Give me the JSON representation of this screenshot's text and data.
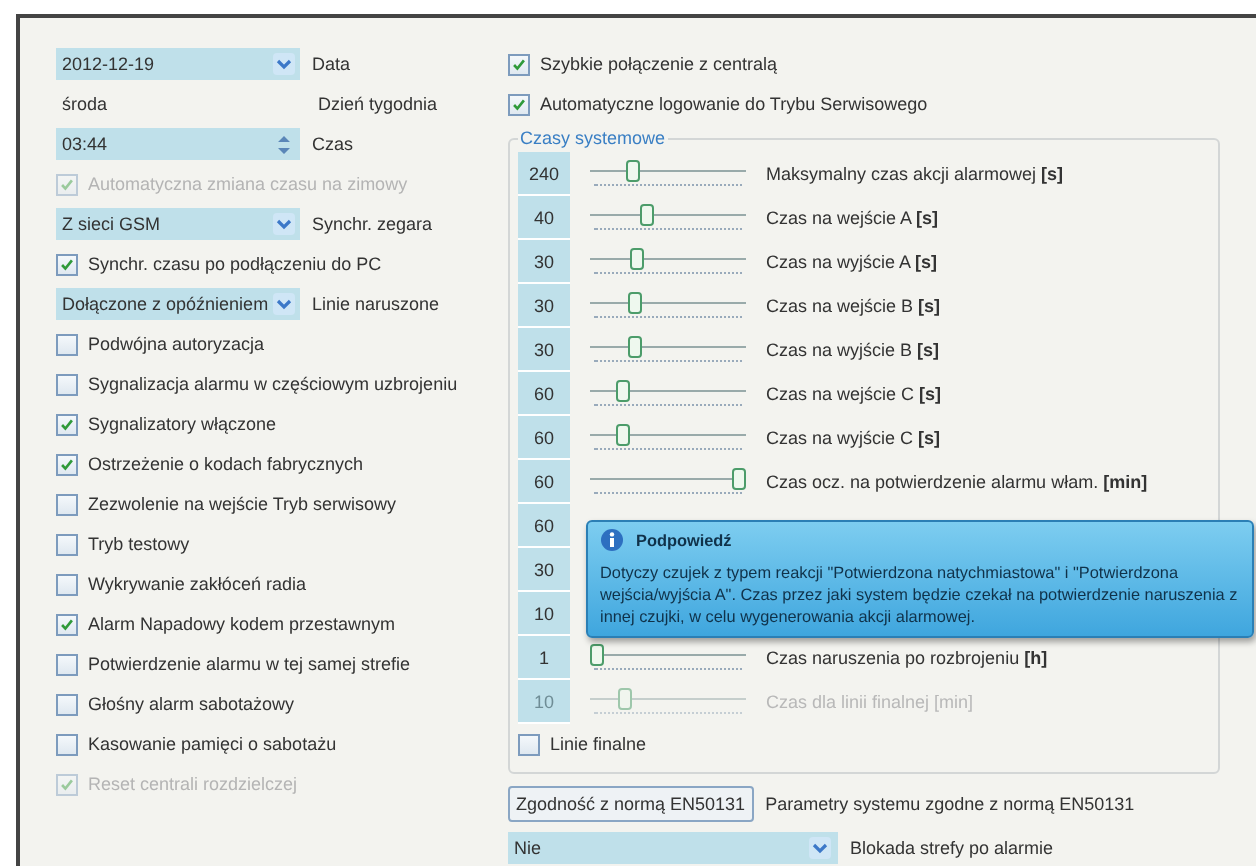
{
  "left_rows": [
    {
      "kind": "dropdown",
      "value": "2012-12-19",
      "label": "Data"
    },
    {
      "kind": "text",
      "value": "środa",
      "label": "Dzień tygodnia"
    },
    {
      "kind": "spinner",
      "value": "03:44",
      "label": "Czas"
    },
    {
      "kind": "checkbox",
      "text": "Automatyczna zmiana czasu na zimowy",
      "checked": true,
      "disabled": true
    },
    {
      "kind": "dropdown",
      "value": "Z sieci GSM",
      "label": "Synchr. zegara"
    },
    {
      "kind": "checkbox",
      "text": "Synchr. czasu po podłączeniu do PC",
      "checked": true,
      "disabled": false
    },
    {
      "kind": "dropdown",
      "value": "Dołączone z opóźnieniem",
      "label": "Linie naruszone"
    },
    {
      "kind": "checkbox",
      "label": "Podwójna autoryzacja",
      "checked": false,
      "disabled": false
    },
    {
      "kind": "checkbox",
      "label": "Sygnalizacja alarmu w częściowym uzbrojeniu",
      "checked": false,
      "disabled": false
    },
    {
      "kind": "checkbox",
      "label": "Sygnalizatory włączone",
      "checked": true,
      "disabled": false
    },
    {
      "kind": "checkbox",
      "label": "Ostrzeżenie o kodach fabrycznych",
      "checked": true,
      "disabled": false
    },
    {
      "kind": "checkbox",
      "label": "Zezwolenie na wejście Tryb serwisowy",
      "checked": false,
      "disabled": false
    },
    {
      "kind": "checkbox",
      "label": "Tryb testowy",
      "checked": false,
      "disabled": false
    },
    {
      "kind": "checkbox",
      "label": "Wykrywanie zakłóceń radia",
      "checked": false,
      "disabled": false
    },
    {
      "kind": "checkbox",
      "label": "Alarm Napadowy kodem przestawnym",
      "checked": true,
      "disabled": false
    },
    {
      "kind": "checkbox",
      "label": "Potwierdzenie alarmu w tej samej strefie",
      "checked": false,
      "disabled": false
    },
    {
      "kind": "checkbox",
      "label": "Głośny alarm sabotażowy",
      "checked": false,
      "disabled": false
    },
    {
      "kind": "checkbox",
      "label": "Kasowanie pamięci o sabotażu",
      "checked": false,
      "disabled": false
    },
    {
      "kind": "checkbox",
      "label": "Reset centrali rozdzielczej",
      "checked": true,
      "disabled": true
    }
  ],
  "right_options": [
    {
      "label": "Szybkie połączenie z centralą",
      "checked": true
    },
    {
      "label": "Automatyczne logowanie do Trybu Serwisowego",
      "checked": true
    }
  ],
  "system_times": {
    "title": "Czasy systemowe",
    "rows": [
      {
        "value": "240",
        "level": 0.25,
        "label": "Maksymalny czas akcji alarmowej **[s]**",
        "disabled": false
      },
      {
        "value": "40",
        "level": 0.35,
        "label": "Czas na wejście A **[s]**",
        "disabled": false
      },
      {
        "value": "30",
        "level": 0.28,
        "label": "Czas na wyjście A **[s]**",
        "disabled": false
      },
      {
        "value": "30",
        "level": 0.27,
        "label": "Czas na wejście B **[s]**",
        "disabled": false
      },
      {
        "value": "30",
        "level": 0.27,
        "label": "Czas na wyjście B **[s]**",
        "disabled": false
      },
      {
        "value": "60",
        "level": 0.18,
        "label": "Czas na wejście C **[s]**",
        "disabled": false
      },
      {
        "value": "60",
        "level": 0.18,
        "label": "Czas na wyjście C **[s]**",
        "disabled": false
      },
      {
        "value": "60",
        "level": 1,
        "label": "Czas ocz. na potwierdzenie alarmu włam. **[min]**",
        "disabled": false
      },
      {
        "value": "60",
        "disabled": false
      },
      {
        "value": "30",
        "disabled": false
      },
      {
        "value": "10",
        "disabled": false
      },
      {
        "value": "1",
        "level": 0,
        "label": "Czas naruszenia po rozbrojeniu **[h]**",
        "disabled": false
      },
      {
        "value": "10",
        "level": 0.2,
        "label": "Czas dla linii finalnej [min]",
        "disabled": true
      }
    ],
    "final_lines": {
      "label": "Linie finalne",
      "checked": false
    }
  },
  "tooltip": {
    "title": "Podpowiedź",
    "text": "Dotyczy czujek z typem reakcji \"Potwierdzona natychmiastowa\" i \"Potwierdzona wejścia/wyjścia A\". Czas  przez jaki system będzie czekał na potwierdzenie naruszenia z innej czujki, w celu wygenerowania akcji alarmowej."
  },
  "compliance": {
    "button": "Zgodność z normą EN50131",
    "label": "Parametry systemu zgodne z normą EN50131"
  },
  "zone_lock": {
    "value": "Nie",
    "label": "Blokada strefy po alarmie"
  }
}
